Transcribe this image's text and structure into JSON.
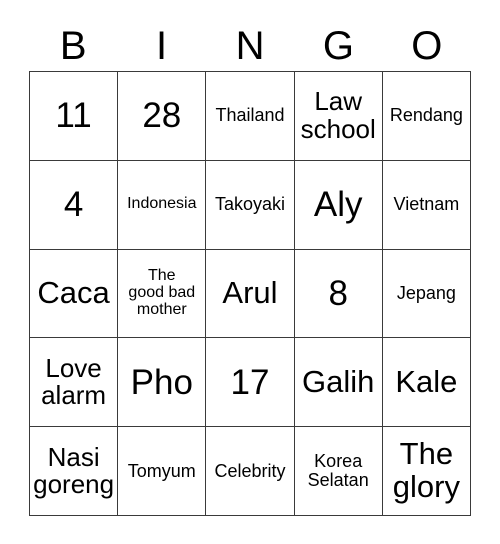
{
  "card": {
    "title_letters": [
      "B",
      "I",
      "N",
      "G",
      "O"
    ],
    "columns": 5,
    "rows": 5,
    "border_color": "#3a3a3a",
    "background_color": "#ffffff",
    "text_color": "#000000",
    "cells": [
      {
        "text": "11",
        "size": "xl"
      },
      {
        "text": "28",
        "size": "xl"
      },
      {
        "text": "Thailand",
        "size": "sm"
      },
      {
        "text": "Law\nschool",
        "size": "md"
      },
      {
        "text": "Rendang",
        "size": "sm"
      },
      {
        "text": "4",
        "size": "xl"
      },
      {
        "text": "Indonesia",
        "size": "xs"
      },
      {
        "text": "Takoyaki",
        "size": "sm"
      },
      {
        "text": "Aly",
        "size": "xl"
      },
      {
        "text": "Vietnam",
        "size": "sm"
      },
      {
        "text": "Caca",
        "size": "lg"
      },
      {
        "text": "The\ngood bad\nmother",
        "size": "xs"
      },
      {
        "text": "Arul",
        "size": "lg"
      },
      {
        "text": "8",
        "size": "xl"
      },
      {
        "text": "Jepang",
        "size": "sm"
      },
      {
        "text": "Love\nalarm",
        "size": "md"
      },
      {
        "text": "Pho",
        "size": "xl"
      },
      {
        "text": "17",
        "size": "xl"
      },
      {
        "text": "Galih",
        "size": "lg"
      },
      {
        "text": "Kale",
        "size": "lg"
      },
      {
        "text": "Nasi\ngoreng",
        "size": "md"
      },
      {
        "text": "Tomyum",
        "size": "sm"
      },
      {
        "text": "Celebrity",
        "size": "sm"
      },
      {
        "text": "Korea\nSelatan",
        "size": "sm"
      },
      {
        "text": "The\nglory",
        "size": "lg"
      }
    ]
  }
}
